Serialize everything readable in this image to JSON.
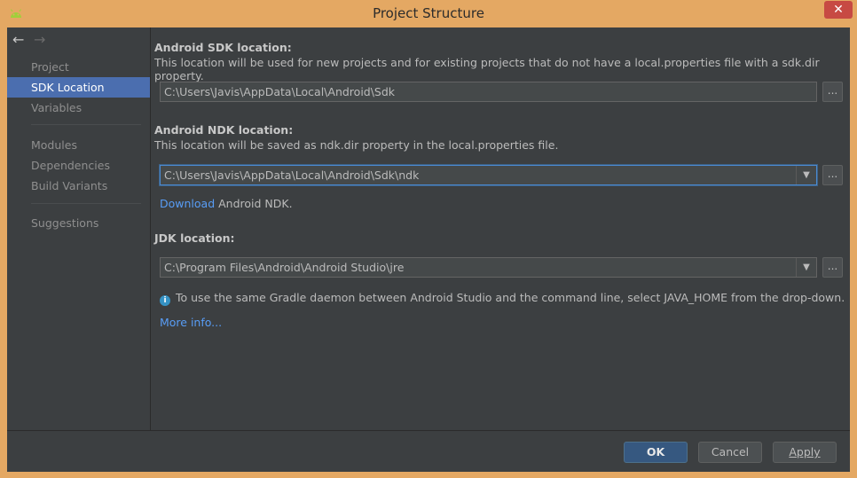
{
  "window": {
    "title": "Project Structure",
    "app_icon": "android-icon",
    "close_glyph": "✕"
  },
  "nav": {
    "back_glyph": "←",
    "forward_glyph": "→"
  },
  "sidebar": {
    "items": [
      {
        "label": "Project",
        "selected": false
      },
      {
        "label": "SDK Location",
        "selected": true
      },
      {
        "label": "Variables",
        "selected": false
      },
      {
        "label": "Modules",
        "selected": false
      },
      {
        "label": "Dependencies",
        "selected": false
      },
      {
        "label": "Build Variants",
        "selected": false
      },
      {
        "label": "Suggestions",
        "selected": false
      }
    ]
  },
  "sdk": {
    "label": "Android SDK location:",
    "description": "This location will be used for new projects and for existing projects that do not have a local.properties file with a sdk.dir property.",
    "value": "C:\\Users\\Javis\\AppData\\Local\\Android\\Sdk",
    "browse": "..."
  },
  "ndk": {
    "label": "Android NDK location:",
    "description": "This location will be saved as ndk.dir property in the local.properties file.",
    "value": "C:\\Users\\Javis\\AppData\\Local\\Android\\Sdk\\ndk",
    "browse": "...",
    "download_link": "Download",
    "download_suffix": " Android NDK."
  },
  "jdk": {
    "label": "JDK location:",
    "value": "C:\\Program Files\\Android\\Android Studio\\jre",
    "browse": "...",
    "info": "To use the same Gradle daemon between Android Studio and the command line, select JAVA_HOME from the drop-down.",
    "more_info": "More info..."
  },
  "footer": {
    "ok": "OK",
    "cancel": "Cancel",
    "apply": "Apply"
  },
  "colors": {
    "accent": "#4b6eaf",
    "link": "#589df6",
    "background": "#3c3f41",
    "frame": "#e4a863"
  }
}
